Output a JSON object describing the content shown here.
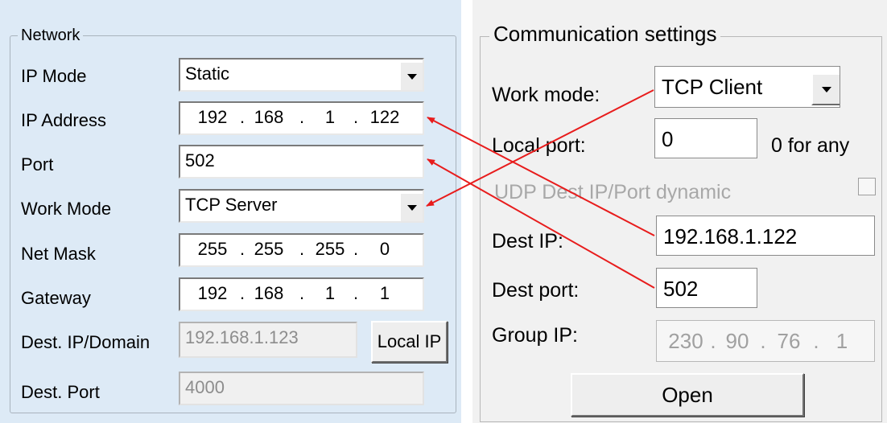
{
  "network": {
    "legend": "Network",
    "ip_mode": {
      "label": "IP Mode",
      "value": "Static"
    },
    "ip_address": {
      "label": "IP Address",
      "octets": [
        "192",
        "168",
        "1",
        "122"
      ]
    },
    "port": {
      "label": "Port",
      "value": "502"
    },
    "work_mode": {
      "label": "Work Mode",
      "value": "TCP Server"
    },
    "net_mask": {
      "label": "Net Mask",
      "octets": [
        "255",
        "255",
        "255",
        "0"
      ]
    },
    "gateway": {
      "label": "Gateway",
      "octets": [
        "192",
        "168",
        "1",
        "1"
      ]
    },
    "dest_ip": {
      "label": "Dest. IP/Domain",
      "value": "192.168.1.123",
      "button": "Local IP"
    },
    "dest_port": {
      "label": "Dest. Port",
      "value": "4000"
    }
  },
  "comm": {
    "legend": "Communication settings",
    "work_mode": {
      "label": "Work mode:",
      "value": "TCP Client"
    },
    "local_port": {
      "label": "Local port:",
      "value": "0",
      "hint": "0 for any"
    },
    "udp_dynamic": {
      "label": "UDP Dest IP/Port dynamic",
      "checked": false
    },
    "dest_ip": {
      "label": "Dest IP:",
      "value": "192.168.1.122"
    },
    "dest_port": {
      "label": "Dest port:",
      "value": "502"
    },
    "group_ip": {
      "label": "Group IP:",
      "octets": [
        "230",
        "90",
        "76",
        "1"
      ]
    },
    "open_button": "Open"
  },
  "colors": {
    "annotation_arrow": "#e81c1c",
    "left_panel_bg": "#ddeaf6",
    "right_panel_bg": "#f1f1f1"
  }
}
